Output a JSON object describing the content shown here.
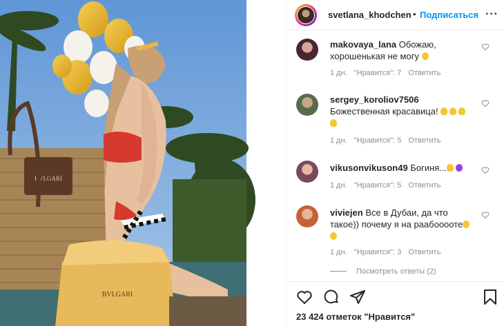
{
  "post": {
    "username": "svetlana_khodchenk",
    "separator": "•",
    "follow_label": "Подписаться",
    "more_label": "···",
    "photo_brand_bag": "BVLGARI",
    "photo_brand_box": "BVLGARI",
    "likes_text": "23 424 отметок \"Нравится\""
  },
  "comments": [
    {
      "username": "makovaya_lana",
      "text": "Обожаю, хорошенькая не могу",
      "emoji": "smile",
      "time": "1 дн.",
      "likes": "\"Нравится\": 7",
      "reply": "Ответить"
    },
    {
      "username": "sergey_koroliov7506",
      "text": "Божественная красавица!",
      "emoji": "hands",
      "time": "1 дн.",
      "likes": "\"Нравится\": 5",
      "reply": "Ответить"
    },
    {
      "username": "vikusonvikuson49",
      "text": "Богиня...",
      "emoji": "hand-heart",
      "time": "1 дн.",
      "likes": "\"Нравится\": 5",
      "reply": "Ответить"
    },
    {
      "username": "viviejen",
      "text": "Все в Дубаи, да что такое)) почему я на раабооооте",
      "emoji": "laugh",
      "time": "1 дн.",
      "likes": "\"Нравится\": 3",
      "reply": "Ответить"
    }
  ],
  "view_replies": "Посмотреть ответы (2)",
  "colors": {
    "accent": "#0095f6",
    "text": "#262626",
    "muted": "#8e8e8e",
    "border": "#efefef"
  },
  "icons": [
    "heart-icon",
    "comment-icon",
    "share-icon",
    "bookmark-icon",
    "like-comment-icon"
  ]
}
